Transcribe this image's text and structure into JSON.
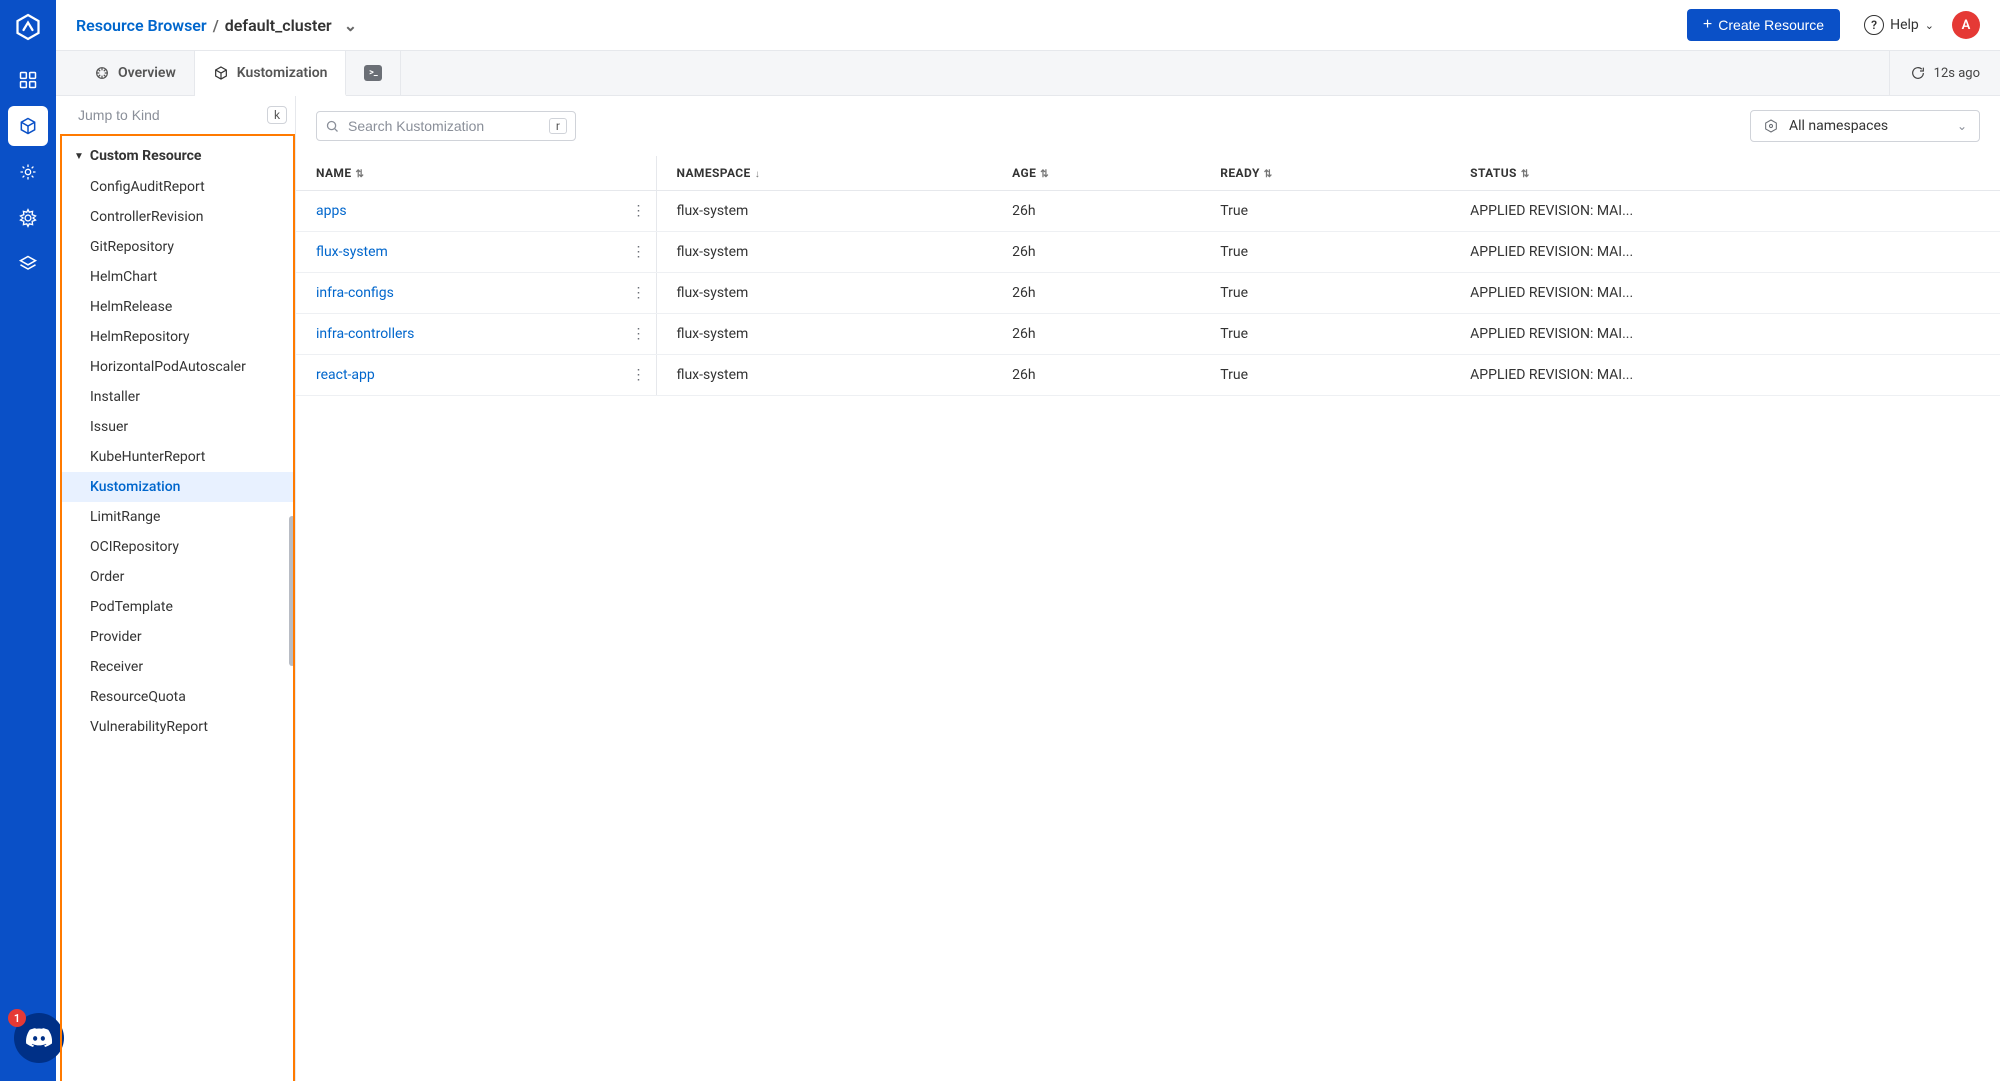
{
  "breadcrumb": {
    "root": "Resource Browser",
    "separator": "/",
    "current": "default_cluster"
  },
  "header": {
    "create_label": "Create Resource",
    "help_label": "Help",
    "avatar_initial": "A"
  },
  "tabs": {
    "overview": "Overview",
    "kustomization": "Kustomization",
    "sync_text": "12s ago"
  },
  "sidebar": {
    "jump_placeholder": "Jump to Kind",
    "jump_shortcut": "k",
    "group_label": "Custom Resource",
    "items": [
      "ConfigAuditReport",
      "ControllerRevision",
      "GitRepository",
      "HelmChart",
      "HelmRelease",
      "HelmRepository",
      "HorizontalPodAutoscaler",
      "Installer",
      "Issuer",
      "KubeHunterReport",
      "Kustomization",
      "LimitRange",
      "OCIRepository",
      "Order",
      "PodTemplate",
      "Provider",
      "Receiver",
      "ResourceQuota",
      "VulnerabilityReport"
    ],
    "active_index": 10
  },
  "toolbar": {
    "search_placeholder": "Search Kustomization",
    "search_shortcut": "r",
    "namespace_label": "All namespaces"
  },
  "columns": {
    "name": "NAME",
    "namespace": "NAMESPACE",
    "age": "AGE",
    "ready": "READY",
    "status": "STATUS"
  },
  "rows": [
    {
      "name": "apps",
      "namespace": "flux-system",
      "age": "26h",
      "ready": "True",
      "status": "APPLIED REVISION: MAI..."
    },
    {
      "name": "flux-system",
      "namespace": "flux-system",
      "age": "26h",
      "ready": "True",
      "status": "APPLIED REVISION: MAI..."
    },
    {
      "name": "infra-configs",
      "namespace": "flux-system",
      "age": "26h",
      "ready": "True",
      "status": "APPLIED REVISION: MAI..."
    },
    {
      "name": "infra-controllers",
      "namespace": "flux-system",
      "age": "26h",
      "ready": "True",
      "status": "APPLIED REVISION: MAI..."
    },
    {
      "name": "react-app",
      "namespace": "flux-system",
      "age": "26h",
      "ready": "True",
      "status": "APPLIED REVISION: MAI..."
    }
  ],
  "discord_badge": "1"
}
